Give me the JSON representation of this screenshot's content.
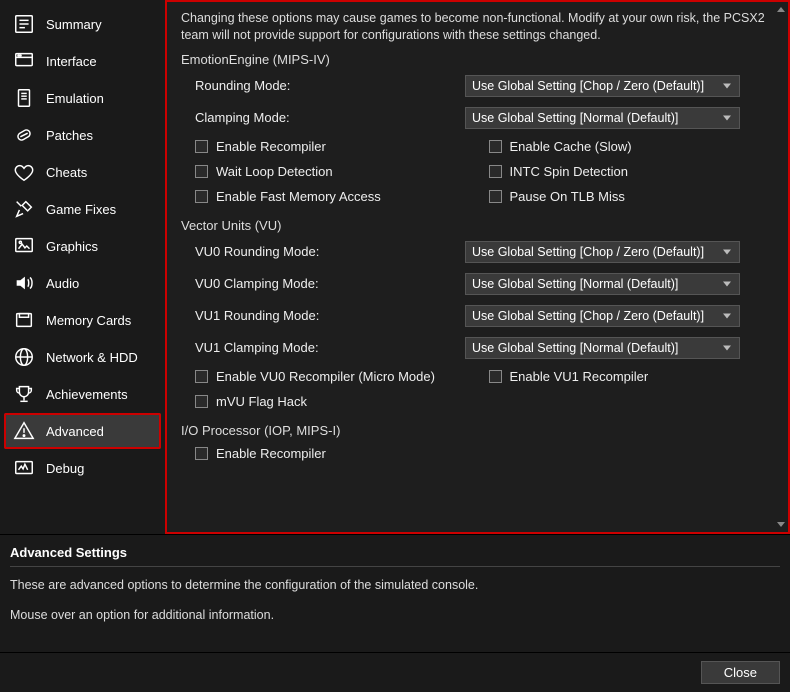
{
  "sidebar": {
    "items": [
      {
        "label": "Summary",
        "icon": "summary-icon"
      },
      {
        "label": "Interface",
        "icon": "interface-icon"
      },
      {
        "label": "Emulation",
        "icon": "emulation-icon"
      },
      {
        "label": "Patches",
        "icon": "patches-icon"
      },
      {
        "label": "Cheats",
        "icon": "cheats-icon"
      },
      {
        "label": "Game Fixes",
        "icon": "gamefixes-icon"
      },
      {
        "label": "Graphics",
        "icon": "graphics-icon"
      },
      {
        "label": "Audio",
        "icon": "audio-icon"
      },
      {
        "label": "Memory Cards",
        "icon": "memorycards-icon"
      },
      {
        "label": "Network & HDD",
        "icon": "network-icon"
      },
      {
        "label": "Achievements",
        "icon": "achievements-icon"
      },
      {
        "label": "Advanced",
        "icon": "advanced-icon",
        "selected": true
      },
      {
        "label": "Debug",
        "icon": "debug-icon"
      }
    ]
  },
  "main": {
    "warning": "Changing these options may cause games to become non-functional. Modify at your own risk, the PCSX2 team will not provide support for configurations with these settings changed.",
    "groups": {
      "ee": {
        "title": "EmotionEngine (MIPS-IV)",
        "rounding_label": "Rounding Mode:",
        "rounding_value": "Use Global Setting [Chop / Zero (Default)]",
        "clamping_label": "Clamping Mode:",
        "clamping_value": "Use Global Setting [Normal (Default)]",
        "checks": [
          {
            "label": "Enable Recompiler"
          },
          {
            "label": "Enable Cache (Slow)"
          },
          {
            "label": "Wait Loop Detection"
          },
          {
            "label": "INTC Spin Detection"
          },
          {
            "label": "Enable Fast Memory Access"
          },
          {
            "label": "Pause On TLB Miss"
          }
        ]
      },
      "vu": {
        "title": "Vector Units (VU)",
        "vu0_rounding_label": "VU0 Rounding Mode:",
        "vu0_rounding_value": "Use Global Setting [Chop / Zero (Default)]",
        "vu0_clamping_label": "VU0 Clamping Mode:",
        "vu0_clamping_value": "Use Global Setting [Normal (Default)]",
        "vu1_rounding_label": "VU1 Rounding Mode:",
        "vu1_rounding_value": "Use Global Setting [Chop / Zero (Default)]",
        "vu1_clamping_label": "VU1 Clamping Mode:",
        "vu1_clamping_value": "Use Global Setting [Normal (Default)]",
        "checks": [
          {
            "label": "Enable VU0 Recompiler (Micro Mode)"
          },
          {
            "label": "Enable VU1 Recompiler"
          },
          {
            "label": "mVU Flag Hack"
          }
        ]
      },
      "iop": {
        "title": "I/O Processor (IOP, MIPS-I)",
        "checks": [
          {
            "label": "Enable Recompiler"
          }
        ]
      }
    }
  },
  "info": {
    "title": "Advanced Settings",
    "line1": "These are advanced options to determine the configuration of the simulated console.",
    "line2": "Mouse over an option for additional information."
  },
  "footer": {
    "close": "Close"
  }
}
